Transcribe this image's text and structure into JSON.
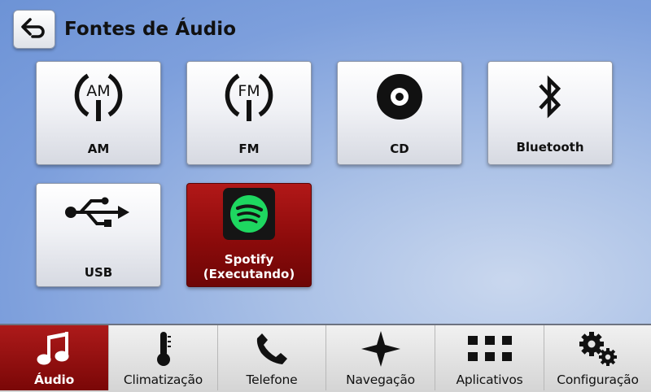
{
  "header": {
    "title": "Fontes de Áudio",
    "back_icon": "back-arrow-icon"
  },
  "sources": [
    {
      "id": "am",
      "label": "AM",
      "icon": "am-radio-icon",
      "icon_text": "AM",
      "active": false
    },
    {
      "id": "fm",
      "label": "FM",
      "icon": "fm-radio-icon",
      "icon_text": "FM",
      "active": false
    },
    {
      "id": "cd",
      "label": "CD",
      "icon": "cd-disc-icon",
      "active": false
    },
    {
      "id": "bluetooth",
      "label": "Bluetooth",
      "icon": "bluetooth-icon",
      "active": false
    },
    {
      "id": "usb",
      "label": "USB",
      "icon": "usb-icon",
      "active": false
    },
    {
      "id": "spotify",
      "label": "Spotify",
      "sublabel": "(Executando)",
      "icon": "spotify-icon",
      "active": true
    }
  ],
  "nav": [
    {
      "label": "Áudio",
      "icon": "music-note-icon",
      "active": true
    },
    {
      "label": "Climatização",
      "icon": "thermometer-icon",
      "active": false
    },
    {
      "label": "Telefone",
      "icon": "phone-icon",
      "active": false
    },
    {
      "label": "Navegação",
      "icon": "navigation-star-icon",
      "active": false
    },
    {
      "label": "Aplicativos",
      "icon": "apps-grid-icon",
      "active": false
    },
    {
      "label": "Configuração",
      "icon": "gears-icon",
      "active": false
    }
  ],
  "colors": {
    "active_red": "#9a0f0f",
    "background_blue": "#7d9fdc",
    "spotify_green": "#1ed760"
  }
}
